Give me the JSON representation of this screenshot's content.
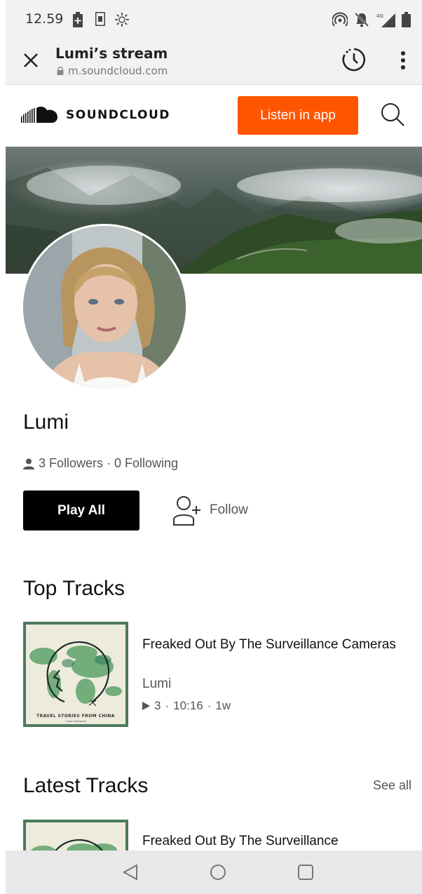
{
  "status_bar": {
    "time": "12.59",
    "network": "4G"
  },
  "browser": {
    "title": "Lumi’s stream",
    "url": "m.soundcloud.com"
  },
  "header": {
    "brand": "SOUNDCLOUD",
    "listen_button": "Listen in app",
    "accent_color": "#ff5500"
  },
  "profile": {
    "name": "Lumi",
    "followers_text": "3 Followers · 0 Following",
    "play_all_label": "Play All",
    "follow_label": "Follow"
  },
  "top_tracks": {
    "heading": "Top Tracks",
    "items": [
      {
        "title": "Freaked Out By The Surveillance Cameras",
        "artist": "Lumi",
        "plays": "3",
        "duration": "10:16",
        "age": "1w",
        "art_caption": "TRAVEL STORIES FROM CHINA",
        "art_sub": "Lumi Suhonen"
      }
    ]
  },
  "latest_tracks": {
    "heading": "Latest Tracks",
    "see_all_label": "See all",
    "items": [
      {
        "title": "Freaked Out By The Surveillance"
      }
    ]
  },
  "nav_bar": {
    "buttons": [
      "back",
      "home",
      "recents"
    ]
  }
}
